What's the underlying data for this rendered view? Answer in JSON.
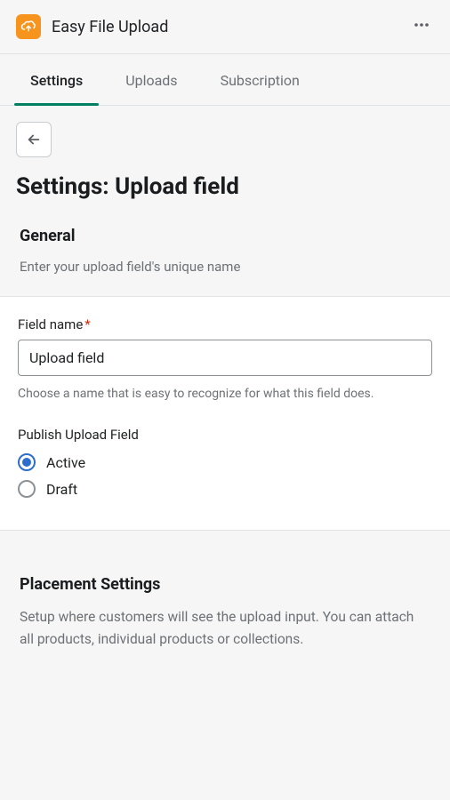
{
  "header": {
    "app_title": "Easy File Upload"
  },
  "tabs": {
    "settings": "Settings",
    "uploads": "Uploads",
    "subscription": "Subscription"
  },
  "page": {
    "title": "Settings: Upload field"
  },
  "general": {
    "title": "General",
    "description": "Enter your upload field's unique name"
  },
  "field_name": {
    "label": "Field name",
    "value": "Upload field",
    "help": "Choose a name that is easy to recognize for what this field does."
  },
  "publish": {
    "label": "Publish Upload Field",
    "options": {
      "active": "Active",
      "draft": "Draft"
    }
  },
  "placement": {
    "title": "Placement Settings",
    "description": "Setup where customers will see the upload input. You can attach all products, individual products or collections."
  }
}
